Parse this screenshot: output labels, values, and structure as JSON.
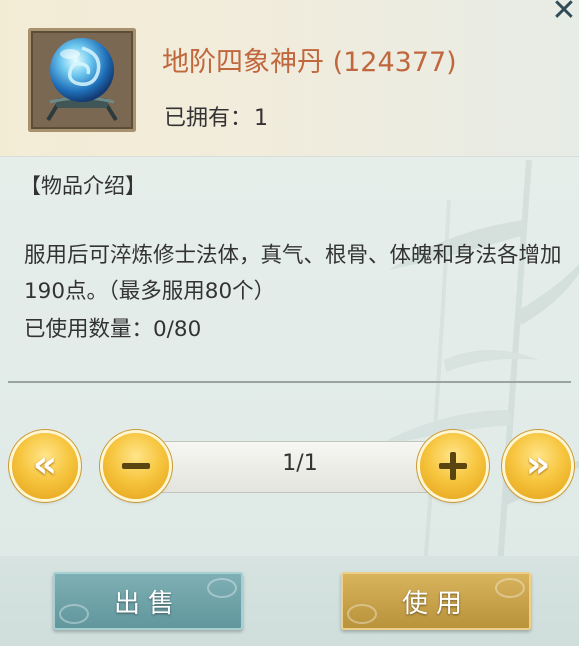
{
  "item": {
    "name": "地阶四象神丹 (124377)",
    "owned_label": "已拥有：",
    "owned_count": "1",
    "icon": "crystal-orb-icon"
  },
  "description": {
    "title": "【物品介绍】",
    "text": "服用后可淬炼修士法体，真气、根骨、体魄和身法各增加190点。（最多服用80个）",
    "used_label": "已使用数量：0/80"
  },
  "pagination": {
    "current": "1/1",
    "first_icon": "double-chevron-left-icon",
    "minus_icon": "minus-icon",
    "plus_icon": "plus-icon",
    "last_icon": "double-chevron-right-icon"
  },
  "actions": {
    "sell_label": "出售",
    "use_label": "使用"
  },
  "close_icon": "close-icon",
  "colors": {
    "item_name": "#c0673e",
    "gold_button": "#f7c640",
    "sell_button": "#6fa3a9",
    "use_button": "#c9a24b"
  }
}
